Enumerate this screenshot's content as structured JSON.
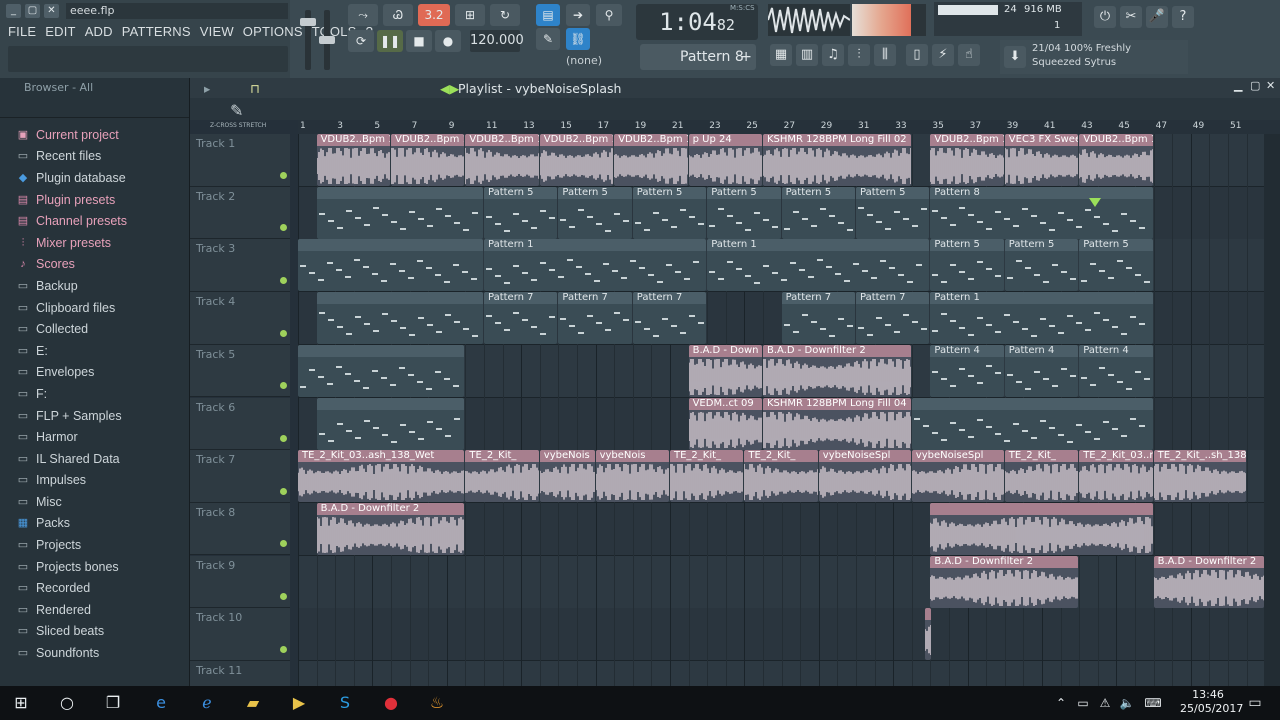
{
  "window": {
    "filename": "eeee.flp",
    "ctrls": [
      "_",
      "▢",
      "✕"
    ]
  },
  "menu": [
    "FILE",
    "EDIT",
    "ADD",
    "PATTERNS",
    "VIEW",
    "OPTIONS",
    "TOOLS",
    "?"
  ],
  "transport": {
    "tempo": "120.000",
    "song_time": "1:04",
    "song_time_sub": "82",
    "time_label": "M:S:CS",
    "snap": "(none)",
    "pattern": "Pattern 8",
    "mode_value": "3.2"
  },
  "monitor": {
    "cpu": "24",
    "ram": "916 MB",
    "voices": "1"
  },
  "hint": {
    "line1": "21/04  100% Freshly",
    "line2": "Squeezed Sytrus"
  },
  "browser": {
    "header": "Browser - All",
    "items": [
      {
        "label": "Current project",
        "icon": "project-icon",
        "highlight": true
      },
      {
        "label": "Recent files",
        "icon": "folder-icon",
        "highlight": false
      },
      {
        "label": "Plugin database",
        "icon": "plugin-icon",
        "highlight": false
      },
      {
        "label": "Plugin presets",
        "icon": "preset-icon",
        "highlight": true
      },
      {
        "label": "Channel presets",
        "icon": "preset-icon",
        "highlight": true
      },
      {
        "label": "Mixer presets",
        "icon": "mixer-icon",
        "highlight": true
      },
      {
        "label": "Scores",
        "icon": "note-icon",
        "highlight": true
      },
      {
        "label": "Backup",
        "icon": "folder-icon",
        "highlight": false
      },
      {
        "label": "Clipboard files",
        "icon": "folder-icon",
        "highlight": false
      },
      {
        "label": "Collected",
        "icon": "folder-icon",
        "highlight": false
      },
      {
        "label": "E:",
        "icon": "folder-icon",
        "highlight": false
      },
      {
        "label": "Envelopes",
        "icon": "folder-icon",
        "highlight": false
      },
      {
        "label": "F:",
        "icon": "folder-icon",
        "highlight": false
      },
      {
        "label": "FLP + Samples",
        "icon": "folder-icon",
        "highlight": false
      },
      {
        "label": "Harmor",
        "icon": "folder-icon",
        "highlight": false
      },
      {
        "label": "IL Shared Data",
        "icon": "folder-icon",
        "highlight": false
      },
      {
        "label": "Impulses",
        "icon": "folder-icon",
        "highlight": false
      },
      {
        "label": "Misc",
        "icon": "folder-icon",
        "highlight": false
      },
      {
        "label": "Packs",
        "icon": "pack-icon",
        "highlight": false
      },
      {
        "label": "Projects",
        "icon": "folder-icon",
        "highlight": false
      },
      {
        "label": "Projects bones",
        "icon": "folder-icon",
        "highlight": false
      },
      {
        "label": "Recorded",
        "icon": "folder-icon",
        "highlight": false
      },
      {
        "label": "Rendered",
        "icon": "folder-icon",
        "highlight": false
      },
      {
        "label": "Sliced beats",
        "icon": "folder-icon",
        "highlight": false
      },
      {
        "label": "Soundfonts",
        "icon": "folder-icon",
        "highlight": false
      }
    ]
  },
  "playlist": {
    "title": "Playlist - vybeNoiseSplash",
    "ruler": [
      "1",
      "3",
      "5",
      "7",
      "9",
      "11",
      "13",
      "15",
      "17",
      "19",
      "21",
      "23",
      "25",
      "27",
      "29",
      "31",
      "33",
      "35",
      "37",
      "39",
      "41",
      "43",
      "45",
      "47",
      "49",
      "51"
    ],
    "labels": {
      "zoom": "Z-CROSS",
      "stretch": "STRETCH"
    },
    "tracks": [
      "Track 1",
      "Track 2",
      "Track 3",
      "Track 4",
      "Track 5",
      "Track 6",
      "Track 7",
      "Track 8",
      "Track 9",
      "Track 10",
      "Track 11"
    ],
    "clips": [
      {
        "track": 0,
        "start": 1,
        "len": 4,
        "label": "VDUB2..Bpm 1",
        "type": "audio"
      },
      {
        "track": 0,
        "start": 5,
        "len": 4,
        "label": "VDUB2..Bpm 1",
        "type": "audio"
      },
      {
        "track": 0,
        "start": 9,
        "len": 4,
        "label": "VDUB2..Bpm 1",
        "type": "audio"
      },
      {
        "track": 0,
        "start": 13,
        "len": 4,
        "label": "VDUB2..Bpm 1",
        "type": "audio"
      },
      {
        "track": 0,
        "start": 17,
        "len": 4,
        "label": "VDUB2..Bpm 1",
        "type": "audio"
      },
      {
        "track": 0,
        "start": 21,
        "len": 4,
        "label": "p Up 24",
        "type": "audio"
      },
      {
        "track": 0,
        "start": 25,
        "len": 8,
        "label": "KSHMR 128BPM Long Fill 02",
        "type": "audio"
      },
      {
        "track": 0,
        "start": 34,
        "len": 4,
        "label": "VDUB2..Bpm 1",
        "type": "audio"
      },
      {
        "track": 0,
        "start": 38,
        "len": 4,
        "label": "VEC3 FX Swee",
        "type": "audio"
      },
      {
        "track": 0,
        "start": 42,
        "len": 4,
        "label": "VDUB2..Bpm 1",
        "type": "audio"
      },
      {
        "track": 1,
        "start": 1,
        "len": 9,
        "label": "",
        "type": "pat"
      },
      {
        "track": 1,
        "start": 10,
        "len": 4,
        "label": "Pattern 5",
        "type": "pat"
      },
      {
        "track": 1,
        "start": 14,
        "len": 4,
        "label": "Pattern 5",
        "type": "pat"
      },
      {
        "track": 1,
        "start": 18,
        "len": 4,
        "label": "Pattern 5",
        "type": "pat"
      },
      {
        "track": 1,
        "start": 22,
        "len": 4,
        "label": "Pattern 5",
        "type": "pat"
      },
      {
        "track": 1,
        "start": 26,
        "len": 4,
        "label": "Pattern 5",
        "type": "pat"
      },
      {
        "track": 1,
        "start": 30,
        "len": 4,
        "label": "Pattern 5",
        "type": "pat"
      },
      {
        "track": 1,
        "start": 34,
        "len": 12,
        "label": "Pattern 8",
        "type": "pat"
      },
      {
        "track": 2,
        "start": 0,
        "len": 10,
        "label": "",
        "type": "pat"
      },
      {
        "track": 2,
        "start": 10,
        "len": 12,
        "label": "Pattern 1",
        "type": "pat"
      },
      {
        "track": 2,
        "start": 22,
        "len": 12,
        "label": "Pattern 1",
        "type": "pat"
      },
      {
        "track": 2,
        "start": 34,
        "len": 4,
        "label": "Pattern 5",
        "type": "pat"
      },
      {
        "track": 2,
        "start": 38,
        "len": 4,
        "label": "Pattern 5",
        "type": "pat"
      },
      {
        "track": 2,
        "start": 42,
        "len": 4,
        "label": "Pattern 5",
        "type": "pat"
      },
      {
        "track": 3,
        "start": 1,
        "len": 9,
        "label": "",
        "type": "pat"
      },
      {
        "track": 3,
        "start": 10,
        "len": 4,
        "label": "Pattern 7",
        "type": "pat"
      },
      {
        "track": 3,
        "start": 14,
        "len": 4,
        "label": "Pattern 7",
        "type": "pat"
      },
      {
        "track": 3,
        "start": 18,
        "len": 4,
        "label": "Pattern 7",
        "type": "pat"
      },
      {
        "track": 3,
        "start": 26,
        "len": 4,
        "label": "Pattern 7",
        "type": "pat"
      },
      {
        "track": 3,
        "start": 30,
        "len": 4,
        "label": "Pattern 7",
        "type": "pat"
      },
      {
        "track": 3,
        "start": 34,
        "len": 12,
        "label": "Pattern 1",
        "type": "pat"
      },
      {
        "track": 4,
        "start": 0,
        "len": 9,
        "label": "",
        "type": "pat"
      },
      {
        "track": 4,
        "start": 21,
        "len": 4,
        "label": "B.A.D - Down",
        "type": "audio"
      },
      {
        "track": 4,
        "start": 25,
        "len": 8,
        "label": "B.A.D - Downfilter 2",
        "type": "audio"
      },
      {
        "track": 4,
        "start": 34,
        "len": 4,
        "label": "Pattern 4",
        "type": "pat"
      },
      {
        "track": 4,
        "start": 38,
        "len": 4,
        "label": "Pattern 4",
        "type": "pat"
      },
      {
        "track": 4,
        "start": 42,
        "len": 4,
        "label": "Pattern 4",
        "type": "pat"
      },
      {
        "track": 5,
        "start": 1,
        "len": 8,
        "label": "",
        "type": "pat"
      },
      {
        "track": 5,
        "start": 21,
        "len": 4,
        "label": "VEDM..ct 09",
        "type": "audio"
      },
      {
        "track": 5,
        "start": 25,
        "len": 8,
        "label": "KSHMR 128BPM Long Fill 04",
        "type": "audio"
      },
      {
        "track": 5,
        "start": 33,
        "len": 13,
        "label": "",
        "type": "pat"
      },
      {
        "track": 6,
        "start": 0,
        "len": 9,
        "label": "TE_2_Kit_03..ash_138_Wet",
        "type": "audio"
      },
      {
        "track": 6,
        "start": 9,
        "len": 4,
        "label": "TE_2_Kit_",
        "type": "audio"
      },
      {
        "track": 6,
        "start": 13,
        "len": 3,
        "label": "vybeNois",
        "type": "audio"
      },
      {
        "track": 6,
        "start": 16,
        "len": 4,
        "label": "vybeNois",
        "type": "audio"
      },
      {
        "track": 6,
        "start": 20,
        "len": 4,
        "label": "TE_2_Kit_",
        "type": "audio"
      },
      {
        "track": 6,
        "start": 24,
        "len": 4,
        "label": "TE_2_Kit_",
        "type": "audio"
      },
      {
        "track": 6,
        "start": 28,
        "len": 5,
        "label": "vybeNoiseSpl",
        "type": "audio"
      },
      {
        "track": 6,
        "start": 33,
        "len": 5,
        "label": "vybeNoiseSpl",
        "type": "audio"
      },
      {
        "track": 6,
        "start": 38,
        "len": 4,
        "label": "TE_2_Kit_",
        "type": "audio"
      },
      {
        "track": 6,
        "start": 42,
        "len": 4,
        "label": "TE_2_Kit_03..r",
        "type": "audio"
      },
      {
        "track": 6,
        "start": 46,
        "len": 5,
        "label": "TE_2_Kit_..sh_138_Wet",
        "type": "audio"
      },
      {
        "track": 7,
        "start": 1,
        "len": 8,
        "label": "B.A.D - Downfilter 2",
        "type": "audio"
      },
      {
        "track": 7,
        "start": 34,
        "len": 12,
        "label": "",
        "type": "audio"
      },
      {
        "track": 8,
        "start": 34,
        "len": 8,
        "label": "B.A.D - Downfilter 2",
        "type": "audio"
      },
      {
        "track": 8,
        "start": 46,
        "len": 6,
        "label": "B.A.D - Downfilter 2",
        "type": "audio"
      },
      {
        "track": 9,
        "start": 33.7,
        "len": 0.4,
        "label": "",
        "type": "audio"
      }
    ]
  },
  "taskbar": {
    "time": "13:46",
    "date": "25/05/2017"
  },
  "colors": {
    "accent": "#9be05a",
    "clip_audio": "#a77f8e",
    "clip_pattern": "#4b5e68"
  }
}
